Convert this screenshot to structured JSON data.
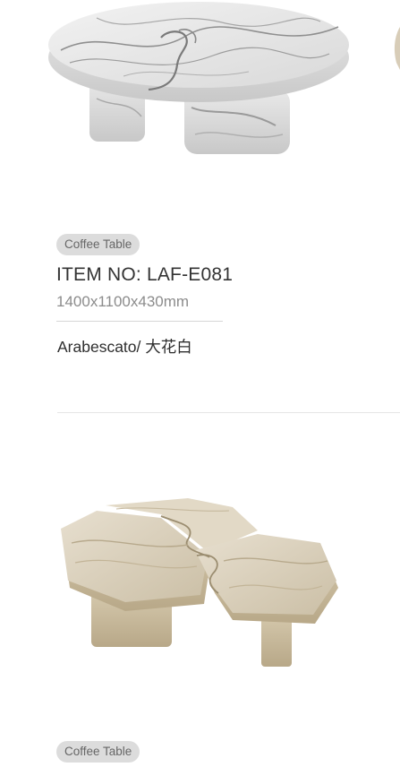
{
  "products": [
    {
      "category": "Coffee Table",
      "item_no": "ITEM NO:  LAF-E081",
      "dimensions": "1400x1100x430mm",
      "material": "Arabescato/ 大花白",
      "image": "arabescato-marble-round-coffee-table"
    },
    {
      "category": "Coffee Table",
      "image": "travertine-puzzle-coffee-table"
    }
  ],
  "colors": {
    "badge_bg": "#dcdcdc",
    "badge_text": "#666666",
    "divider": "#e6e6e6"
  }
}
